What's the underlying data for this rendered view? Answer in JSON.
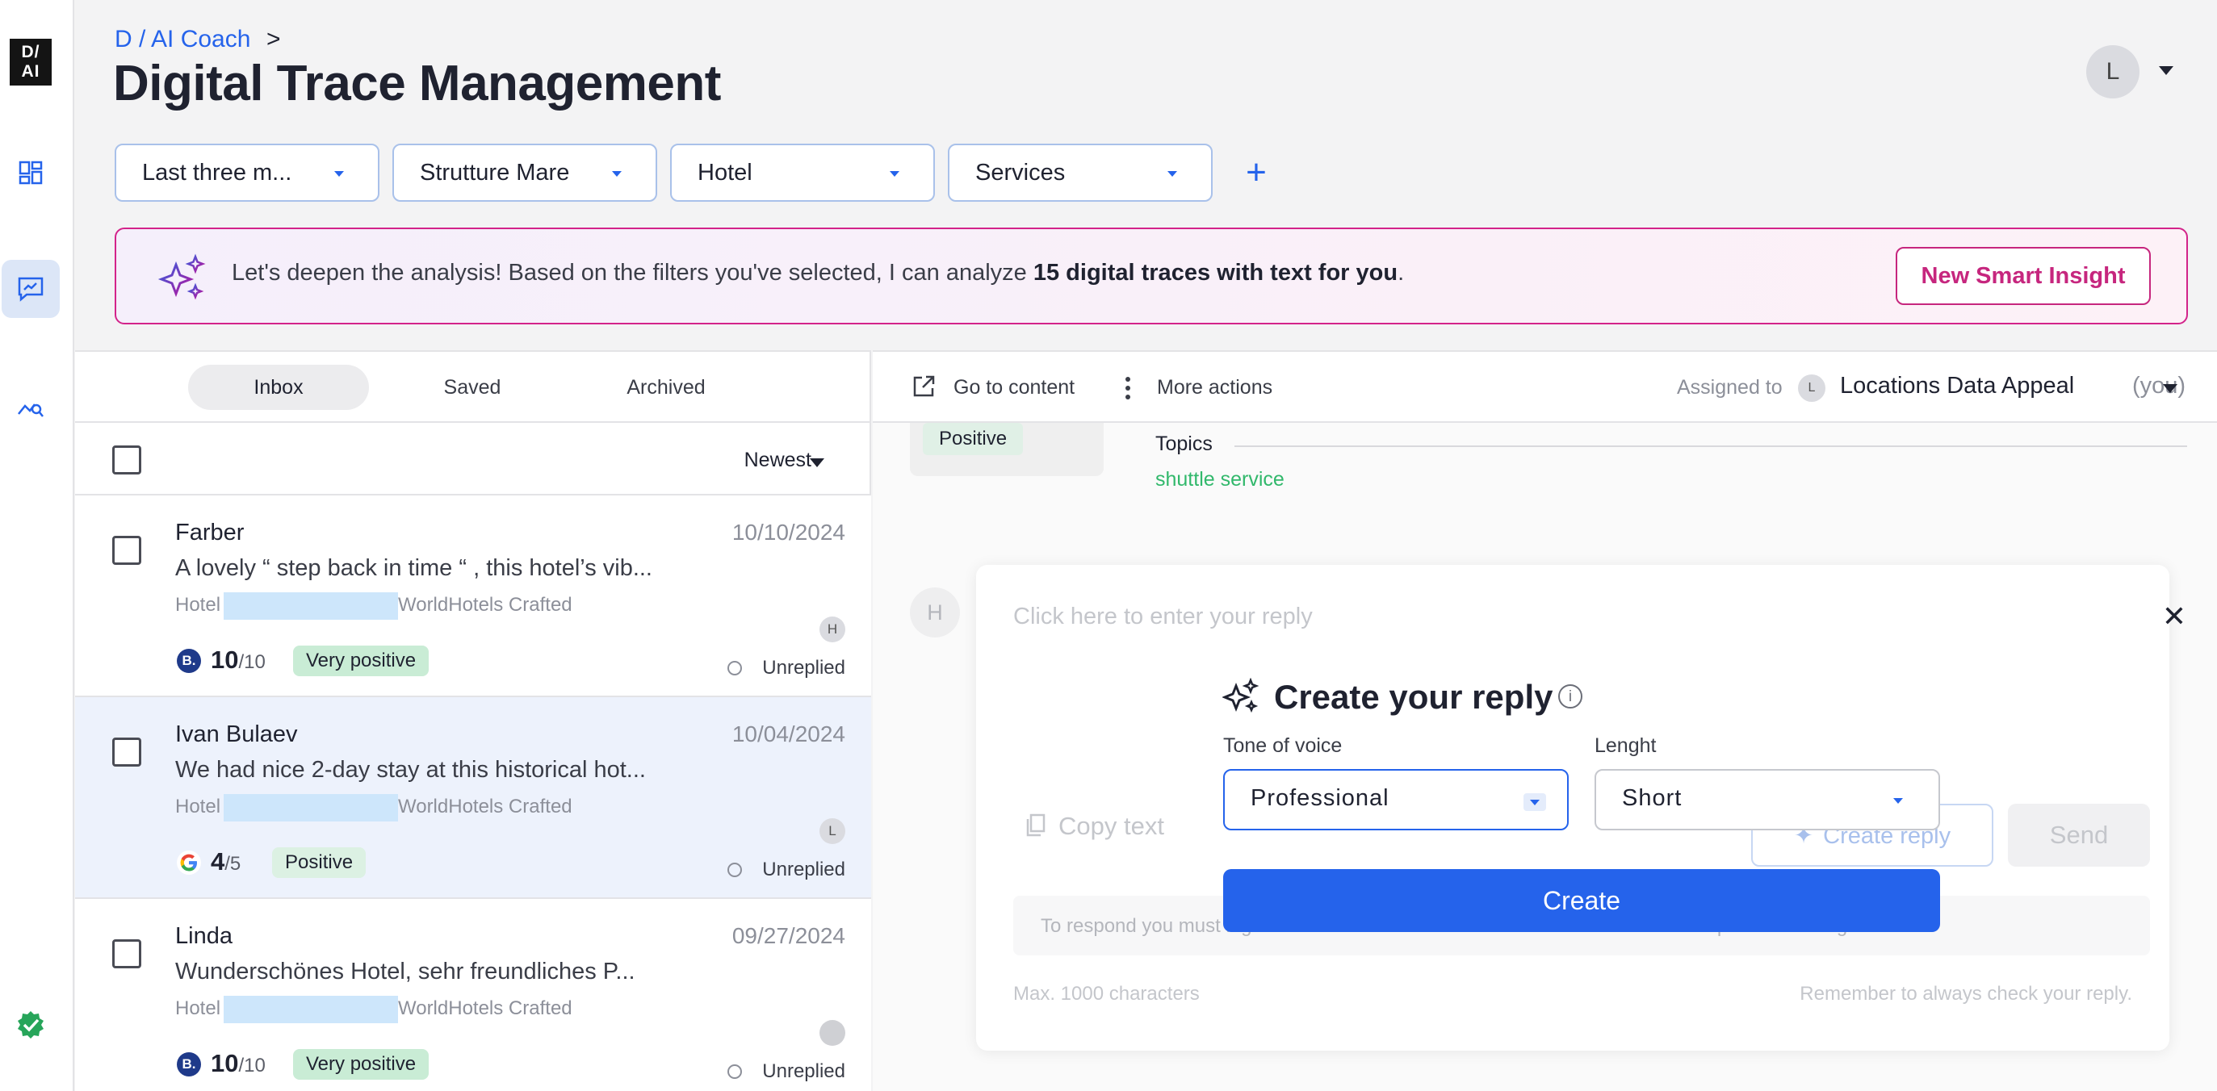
{
  "header": {
    "breadcrumb": "D / AI Coach",
    "breadcrumb_sep": ">",
    "title": "Digital Trace Management",
    "user_initial": "L"
  },
  "logo": {
    "line1": "D/",
    "line2": "AI"
  },
  "filters": [
    {
      "label": "Last three m..."
    },
    {
      "label": "Strutture Mare"
    },
    {
      "label": "Hotel"
    },
    {
      "label": "Services"
    }
  ],
  "add_filter": "+",
  "banner": {
    "text_before": "Let's deepen the analysis! Based on the filters you've selected, I can analyze ",
    "text_bold": "15 digital traces with text for you",
    "text_after": ".",
    "button": "New Smart Insight"
  },
  "inbox": {
    "tabs": [
      "Inbox",
      "Saved",
      "Archived"
    ],
    "sort": "Newest",
    "items": [
      {
        "name": "Farber",
        "date": "10/10/2024",
        "text": "A lovely “ step back in time “ , this hotel’s vib...",
        "loc_prefix": "Hotel",
        "loc_suffix": "WorldHotels Crafted",
        "assignee": "H",
        "source": "B.",
        "score": "10",
        "scale": "/10",
        "sentiment": "Very positive",
        "status": "Unreplied"
      },
      {
        "name": "Ivan Bulaev",
        "date": "10/04/2024",
        "text": "We had nice 2-day stay at this historical hot...",
        "loc_prefix": "Hotel",
        "loc_suffix": "WorldHotels Crafted",
        "assignee": "L",
        "source": "G",
        "score": "4",
        "scale": "/5",
        "sentiment": "Positive",
        "status": "Unreplied"
      },
      {
        "name": "Linda",
        "date": "09/27/2024",
        "text": "Wunderschönes Hotel, sehr freundliches P...",
        "loc_prefix": "Hotel",
        "loc_suffix": "WorldHotels Crafted",
        "assignee": "",
        "source": "B.",
        "score": "10",
        "scale": "/10",
        "sentiment": "Very positive",
        "status": "Unreplied"
      }
    ]
  },
  "detail": {
    "go_to_content": "Go to content",
    "more_actions": "More actions",
    "assigned_label": "Assigned to",
    "assigned_initial": "L",
    "assigned_name": "Locations Data Appeal",
    "assigned_you": "(you)",
    "sentiment": "Positive",
    "topics_label": "Topics",
    "topic": "shuttle service",
    "reply_initial": "H",
    "reply_placeholder": "Click here to enter your reply",
    "copy_text": "Copy text",
    "create_reply": "Create reply",
    "send": "Send",
    "notice": "To respond you must log in to the channel with the account of the business recipient of this digital trace.",
    "max_chars": "Max. 1000 characters",
    "remember": "Remember to always check your reply."
  },
  "dialog": {
    "title": "Create your reply",
    "info": "i",
    "tone_label": "Tone of voice",
    "tone_value": "Professional",
    "length_label": "Lenght",
    "length_value": "Short",
    "create": "Create"
  },
  "colors": {
    "accent": "#2563eb",
    "brand_pink": "#c6267e",
    "positive_bg": "#d4efdc",
    "selected_row": "#edf2fc"
  }
}
